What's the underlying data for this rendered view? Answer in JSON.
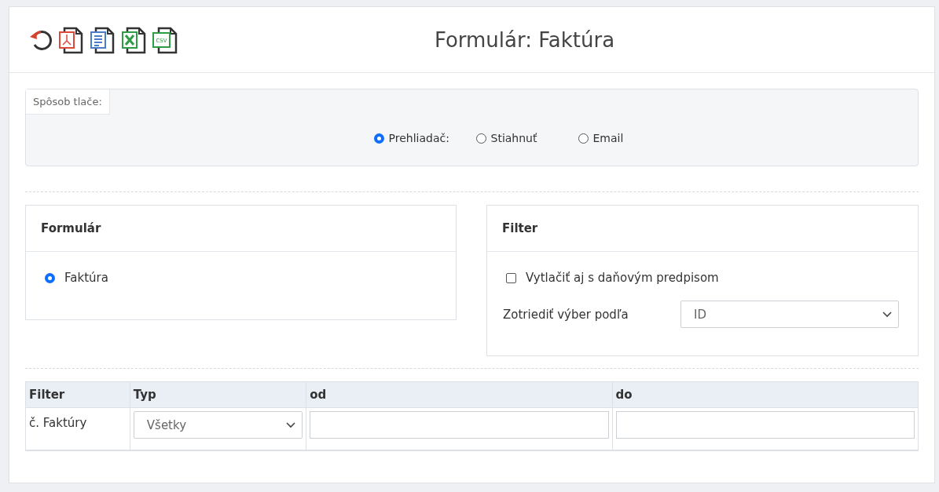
{
  "toolbar": [
    {
      "kind": "reset"
    },
    {
      "kind": "pdf"
    },
    {
      "kind": "doc"
    },
    {
      "kind": "excel"
    },
    {
      "kind": "csv",
      "label": "CSV"
    }
  ],
  "title": "Formulár: Faktúra",
  "print_mode": {
    "label": "Spôsob tlače:",
    "options": [
      {
        "label": "Prehliadač:",
        "selected": true
      },
      {
        "label": "Stiahnuť",
        "selected": false
      },
      {
        "label": "Email",
        "selected": false
      }
    ]
  },
  "form_panel": {
    "title": "Formulár",
    "options": [
      {
        "label": "Faktúra",
        "selected": true
      }
    ]
  },
  "filter_panel": {
    "title": "Filter",
    "checkbox": {
      "label": "Vytlačiť aj s daňovým predpisom",
      "checked": false
    },
    "sort": {
      "label": "Zotriediť výber podľa",
      "value": "ID"
    }
  },
  "table": {
    "columns": [
      "Filter",
      "Typ",
      "od",
      "do"
    ],
    "rows": [
      {
        "filter": "č. Faktúry",
        "type": "Všetky",
        "from": "",
        "to": ""
      }
    ]
  }
}
